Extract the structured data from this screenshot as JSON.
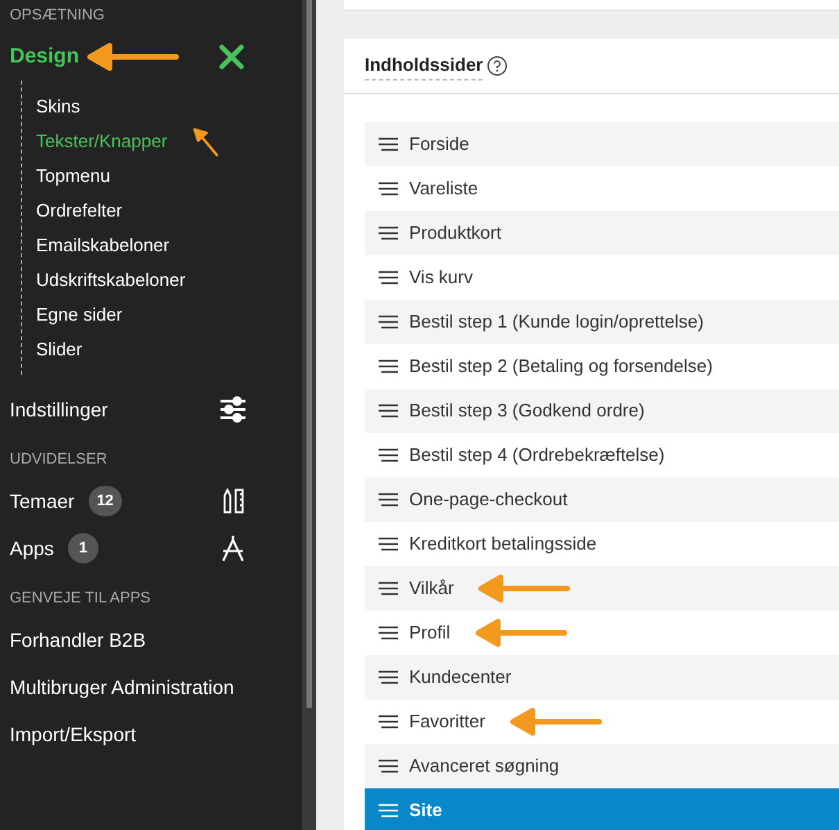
{
  "sidebar": {
    "sections": [
      {
        "heading": "OPSÆTNING",
        "items": [
          {
            "label": "Design",
            "kind": "design",
            "selected": true,
            "annotated": true,
            "children": [
              {
                "label": "Skins",
                "selected": false,
                "annotated": false
              },
              {
                "label": "Tekster/Knapper",
                "selected": true,
                "annotated": true
              },
              {
                "label": "Topmenu",
                "selected": false,
                "annotated": false
              },
              {
                "label": "Ordrefelter",
                "selected": false,
                "annotated": false
              },
              {
                "label": "Emailskabeloner",
                "selected": false,
                "annotated": false
              },
              {
                "label": "Udskriftskabeloner",
                "selected": false,
                "annotated": false
              },
              {
                "label": "Egne sider",
                "selected": false,
                "annotated": false
              },
              {
                "label": "Slider",
                "selected": false,
                "annotated": false
              }
            ]
          },
          {
            "label": "Indstillinger",
            "kind": "settings",
            "selected": false
          }
        ]
      },
      {
        "heading": "UDVIDELSER",
        "items": [
          {
            "label": "Temaer",
            "kind": "themes",
            "badge": "12",
            "selected": false
          },
          {
            "label": "Apps",
            "kind": "apps",
            "badge": "1",
            "selected": false
          }
        ]
      },
      {
        "heading": "GENVEJE TIL APPS",
        "items": [
          {
            "label": "Forhandler B2B",
            "selected": false
          },
          {
            "label": "Multibruger Administration",
            "selected": false
          },
          {
            "label": "Import/Eksport",
            "selected": false
          }
        ]
      }
    ]
  },
  "content": {
    "title": "Indholdssider",
    "pages": [
      {
        "label": "Forside",
        "selected": false,
        "annotated": false
      },
      {
        "label": "Vareliste",
        "selected": false,
        "annotated": false
      },
      {
        "label": "Produktkort",
        "selected": false,
        "annotated": false
      },
      {
        "label": "Vis kurv",
        "selected": false,
        "annotated": false
      },
      {
        "label": "Bestil step 1 (Kunde login/oprettelse)",
        "selected": false,
        "annotated": false
      },
      {
        "label": "Bestil step 2 (Betaling og forsendelse)",
        "selected": false,
        "annotated": false
      },
      {
        "label": "Bestil step 3 (Godkend ordre)",
        "selected": false,
        "annotated": false
      },
      {
        "label": "Bestil step 4 (Ordrebekræftelse)",
        "selected": false,
        "annotated": false
      },
      {
        "label": "One-page-checkout",
        "selected": false,
        "annotated": false
      },
      {
        "label": "Kreditkort betalingsside",
        "selected": false,
        "annotated": false
      },
      {
        "label": "Vilkår",
        "selected": false,
        "annotated": true
      },
      {
        "label": "Profil",
        "selected": false,
        "annotated": true
      },
      {
        "label": "Kundecenter",
        "selected": false,
        "annotated": false
      },
      {
        "label": "Favoritter",
        "selected": false,
        "annotated": true
      },
      {
        "label": "Avanceret søgning",
        "selected": false,
        "annotated": false
      },
      {
        "label": "Site",
        "selected": true,
        "annotated": false
      }
    ]
  }
}
